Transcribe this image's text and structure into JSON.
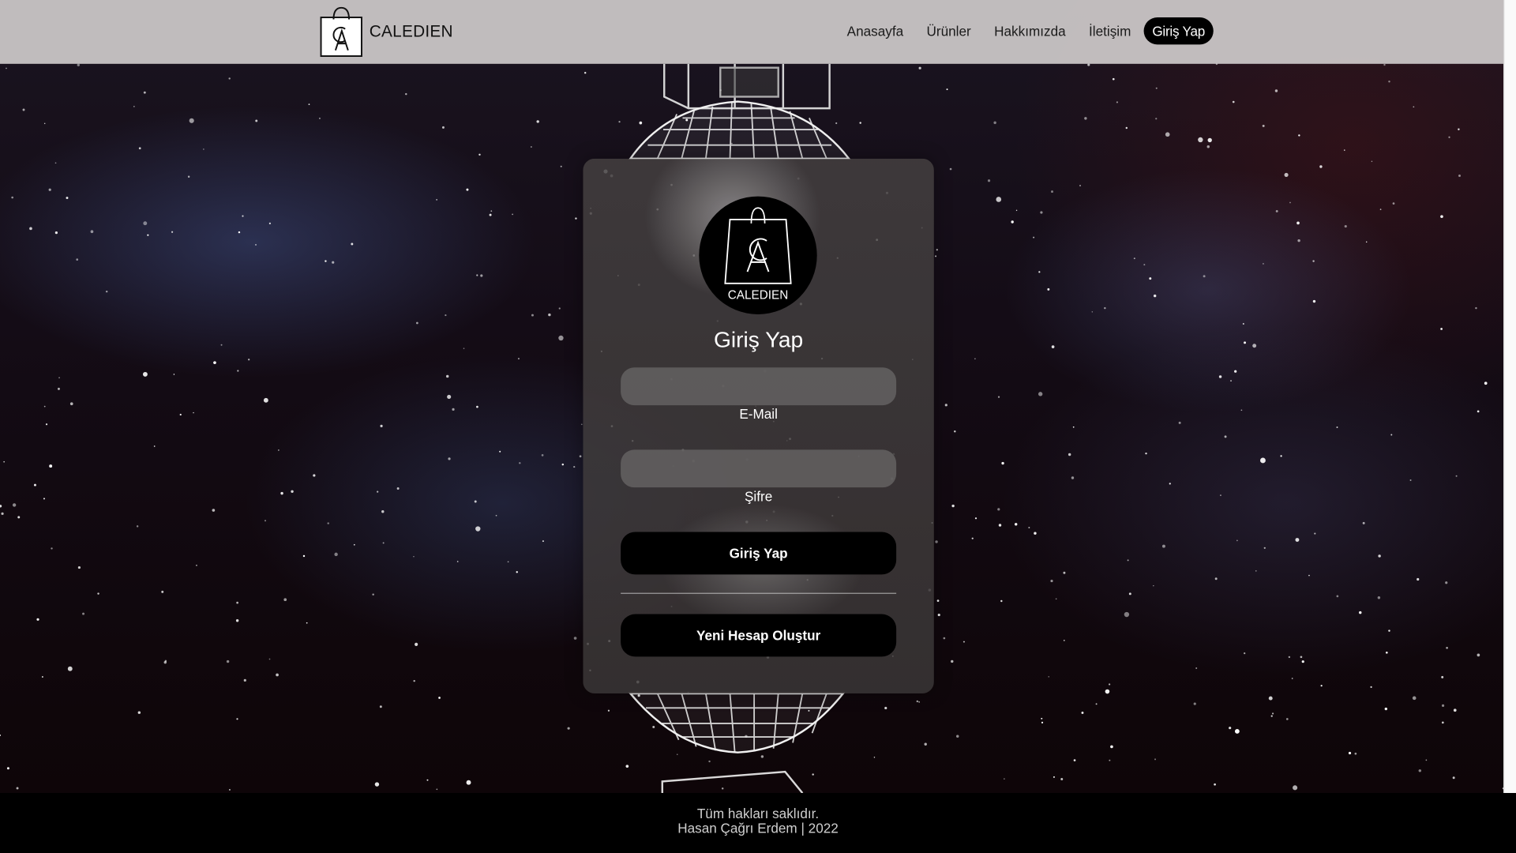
{
  "navbar": {
    "brand_name": "CALEDIEN",
    "links": [
      "Anasayfa",
      "Ürünler",
      "Hakkımızda",
      "İletişim"
    ],
    "login_label": "Giriş Yap"
  },
  "login_card": {
    "logo_text": "CALEDIEN",
    "logo_monogram": "CA",
    "title": "Giriş Yap",
    "email_label": "E-Mail",
    "email_value": "",
    "password_label": "Şifre",
    "password_value": "",
    "submit_label": "Giriş Yap",
    "register_label": "Yeni Hesap Oluştur"
  },
  "footer": {
    "line1": "Tüm hakları saklıdır.",
    "line2": "Hasan Çağrı Erdem | 2022"
  },
  "colors": {
    "navbar_bg": "#cdc9c9",
    "button_bg": "#000000",
    "footer_bg": "#000000",
    "text_light": "#ffffff"
  },
  "icons": {
    "brand_logo": "shopping-bag-ca-icon",
    "card_logo": "shopping-bag-ca-icon"
  }
}
